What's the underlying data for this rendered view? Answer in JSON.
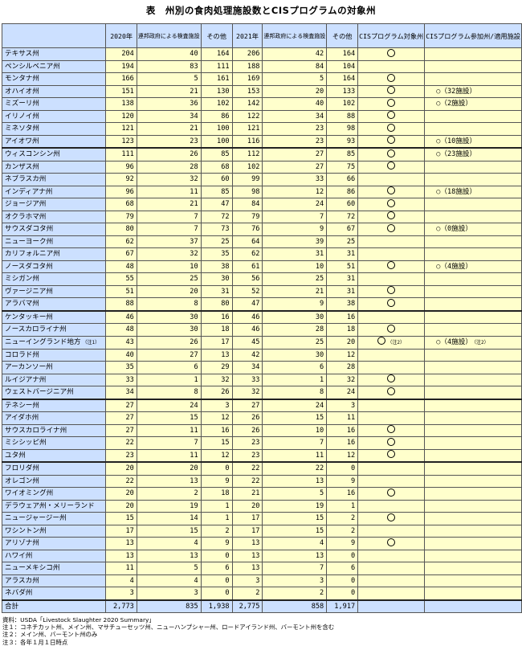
{
  "title": "表　州別の食肉処理施設数とCISプログラムの対象州",
  "headers": {
    "y2020": "2020年",
    "fed2020": "連邦政府による検査施設",
    "other2020": "その他",
    "y2021": "2021年",
    "fed2021": "連邦政府による検査施設",
    "other2021": "その他",
    "cis_target": "CISプログラム対象州",
    "cis_participate": "CISプログラム参加州/適用施設"
  },
  "rows": [
    {
      "state": "テキサス州",
      "a": "204",
      "b": "40",
      "c": "164",
      "d": "206",
      "e": "42",
      "f": "164",
      "g": "○",
      "h": ""
    },
    {
      "state": "ペンシルベニア州",
      "a": "194",
      "b": "83",
      "c": "111",
      "d": "188",
      "e": "84",
      "f": "104",
      "g": "",
      "h": ""
    },
    {
      "state": "モンタナ州",
      "a": "166",
      "b": "5",
      "c": "161",
      "d": "169",
      "e": "5",
      "f": "164",
      "g": "○",
      "h": ""
    },
    {
      "state": "オハイオ州",
      "a": "151",
      "b": "21",
      "c": "130",
      "d": "153",
      "e": "20",
      "f": "133",
      "g": "○",
      "h": "○（32施設）"
    },
    {
      "state": "ミズーリ州",
      "a": "138",
      "b": "36",
      "c": "102",
      "d": "142",
      "e": "40",
      "f": "102",
      "g": "○",
      "h": "○（2施設）"
    },
    {
      "state": "イリノイ州",
      "a": "120",
      "b": "34",
      "c": "86",
      "d": "122",
      "e": "34",
      "f": "88",
      "g": "○",
      "h": ""
    },
    {
      "state": "ミネソタ州",
      "a": "121",
      "b": "21",
      "c": "100",
      "d": "121",
      "e": "23",
      "f": "98",
      "g": "○",
      "h": ""
    },
    {
      "state": "アイオワ州",
      "a": "123",
      "b": "23",
      "c": "100",
      "d": "116",
      "e": "23",
      "f": "93",
      "g": "○",
      "h": "○（10施設）"
    },
    {
      "state": "ウィスコンシン州",
      "a": "111",
      "b": "26",
      "c": "85",
      "d": "112",
      "e": "27",
      "f": "85",
      "g": "○",
      "h": "○（23施設）"
    },
    {
      "state": "カンザス州",
      "a": "96",
      "b": "28",
      "c": "68",
      "d": "102",
      "e": "27",
      "f": "75",
      "g": "○",
      "h": ""
    },
    {
      "state": "ネブラスカ州",
      "a": "92",
      "b": "32",
      "c": "60",
      "d": "99",
      "e": "33",
      "f": "66",
      "g": "",
      "h": ""
    },
    {
      "state": "インディアナ州",
      "a": "96",
      "b": "11",
      "c": "85",
      "d": "98",
      "e": "12",
      "f": "86",
      "g": "○",
      "h": "○（18施設）"
    },
    {
      "state": "ジョージア州",
      "a": "68",
      "b": "21",
      "c": "47",
      "d": "84",
      "e": "24",
      "f": "60",
      "g": "○",
      "h": ""
    },
    {
      "state": "オクラホマ州",
      "a": "79",
      "b": "7",
      "c": "72",
      "d": "79",
      "e": "7",
      "f": "72",
      "g": "○",
      "h": ""
    },
    {
      "state": "サウスダコタ州",
      "a": "80",
      "b": "7",
      "c": "73",
      "d": "76",
      "e": "9",
      "f": "67",
      "g": "○",
      "h": "○（0施設）"
    },
    {
      "state": "ニューヨーク州",
      "a": "62",
      "b": "37",
      "c": "25",
      "d": "64",
      "e": "39",
      "f": "25",
      "g": "",
      "h": ""
    },
    {
      "state": "カリフォルニア州",
      "a": "67",
      "b": "32",
      "c": "35",
      "d": "62",
      "e": "31",
      "f": "31",
      "g": "",
      "h": ""
    },
    {
      "state": "ノースダコタ州",
      "a": "48",
      "b": "10",
      "c": "38",
      "d": "61",
      "e": "10",
      "f": "51",
      "g": "○",
      "h": "○（4施設）"
    },
    {
      "state": "ミシガン州",
      "a": "55",
      "b": "25",
      "c": "30",
      "d": "56",
      "e": "25",
      "f": "31",
      "g": "",
      "h": ""
    },
    {
      "state": "ヴァージニア州",
      "a": "51",
      "b": "20",
      "c": "31",
      "d": "52",
      "e": "21",
      "f": "31",
      "g": "○",
      "h": ""
    },
    {
      "state": "アラバマ州",
      "a": "88",
      "b": "8",
      "c": "80",
      "d": "47",
      "e": "9",
      "f": "38",
      "g": "○",
      "h": ""
    },
    {
      "state": "ケンタッキー州",
      "a": "46",
      "b": "30",
      "c": "16",
      "d": "46",
      "e": "30",
      "f": "16",
      "g": "",
      "h": ""
    },
    {
      "state": "ノースカロライナ州",
      "a": "48",
      "b": "30",
      "c": "18",
      "d": "46",
      "e": "28",
      "f": "18",
      "g": "○",
      "h": ""
    },
    {
      "state": "ニューイングランド地方",
      "sup": "（注1）",
      "a": "43",
      "b": "26",
      "c": "17",
      "d": "45",
      "e": "25",
      "f": "20",
      "g": "○",
      "gnote": "（注2）",
      "h": "○（4施設）",
      "hnote": "（注2）"
    },
    {
      "state": "コロラド州",
      "a": "40",
      "b": "27",
      "c": "13",
      "d": "42",
      "e": "30",
      "f": "12",
      "g": "",
      "h": ""
    },
    {
      "state": "アーカンソー州",
      "a": "35",
      "b": "6",
      "c": "29",
      "d": "34",
      "e": "6",
      "f": "28",
      "g": "",
      "h": ""
    },
    {
      "state": "ルイジアナ州",
      "a": "33",
      "b": "1",
      "c": "32",
      "d": "33",
      "e": "1",
      "f": "32",
      "g": "○",
      "h": ""
    },
    {
      "state": "ウェストバージニア州",
      "a": "34",
      "b": "8",
      "c": "26",
      "d": "32",
      "e": "8",
      "f": "24",
      "g": "○",
      "h": ""
    },
    {
      "state": "テネシー州",
      "a": "27",
      "b": "24",
      "c": "3",
      "d": "27",
      "e": "24",
      "f": "3",
      "g": "",
      "h": ""
    },
    {
      "state": "アイダホ州",
      "a": "27",
      "b": "15",
      "c": "12",
      "d": "26",
      "e": "15",
      "f": "11",
      "g": "",
      "h": ""
    },
    {
      "state": "サウスカロライナ州",
      "a": "27",
      "b": "11",
      "c": "16",
      "d": "26",
      "e": "10",
      "f": "16",
      "g": "○",
      "h": ""
    },
    {
      "state": "ミシシッピ州",
      "a": "22",
      "b": "7",
      "c": "15",
      "d": "23",
      "e": "7",
      "f": "16",
      "g": "○",
      "h": ""
    },
    {
      "state": "ユタ州",
      "a": "23",
      "b": "11",
      "c": "12",
      "d": "23",
      "e": "11",
      "f": "12",
      "g": "○",
      "h": ""
    },
    {
      "state": "フロリダ州",
      "a": "20",
      "b": "20",
      "c": "0",
      "d": "22",
      "e": "22",
      "f": "0",
      "g": "",
      "h": ""
    },
    {
      "state": "オレゴン州",
      "a": "22",
      "b": "13",
      "c": "9",
      "d": "22",
      "e": "13",
      "f": "9",
      "g": "",
      "h": ""
    },
    {
      "state": "ワイオミング州",
      "a": "20",
      "b": "2",
      "c": "18",
      "d": "21",
      "e": "5",
      "f": "16",
      "g": "○",
      "h": ""
    },
    {
      "state": "デラウェア州・メリーランド",
      "a": "20",
      "b": "19",
      "c": "1",
      "d": "20",
      "e": "19",
      "f": "1",
      "g": "",
      "h": ""
    },
    {
      "state": "ニュージャージー州",
      "a": "15",
      "b": "14",
      "c": "1",
      "d": "17",
      "e": "15",
      "f": "2",
      "g": "○",
      "h": ""
    },
    {
      "state": "ワシントン州",
      "a": "17",
      "b": "15",
      "c": "2",
      "d": "17",
      "e": "15",
      "f": "2",
      "g": "",
      "h": ""
    },
    {
      "state": "アリゾナ州",
      "a": "13",
      "b": "4",
      "c": "9",
      "d": "13",
      "e": "4",
      "f": "9",
      "g": "○",
      "h": ""
    },
    {
      "state": "ハワイ州",
      "a": "13",
      "b": "13",
      "c": "0",
      "d": "13",
      "e": "13",
      "f": "0",
      "g": "",
      "h": ""
    },
    {
      "state": "ニューメキシコ州",
      "a": "11",
      "b": "5",
      "c": "6",
      "d": "13",
      "e": "7",
      "f": "6",
      "g": "",
      "h": ""
    },
    {
      "state": "アラスカ州",
      "a": "4",
      "b": "4",
      "c": "0",
      "d": "3",
      "e": "3",
      "f": "0",
      "g": "",
      "h": ""
    },
    {
      "state": "ネバダ州",
      "a": "3",
      "b": "3",
      "c": "0",
      "d": "2",
      "e": "2",
      "f": "0",
      "g": "",
      "h": ""
    }
  ],
  "total": {
    "label": "合計",
    "a": "2,773",
    "b": "835",
    "c": "1,938",
    "d": "2,775",
    "e": "858",
    "f": "1,917"
  },
  "notes": [
    "資料：USDA「Livestock Slaughter 2020 Summary」",
    "注１：コネチカット州、メイン州、マサチューセッツ州、ニューハンプシャー州、ロードアイランド州、バーモント州を含む",
    "注２：メイン州、バーモント州のみ",
    "注３：各年１月１日時点"
  ]
}
